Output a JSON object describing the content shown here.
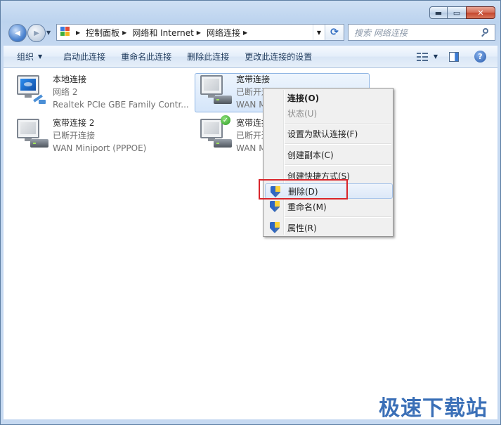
{
  "window": {
    "caption_buttons": {
      "minimize": "▬",
      "maximize": "▭",
      "close": "✕"
    }
  },
  "nav": {
    "back_symbol": "◀",
    "forward_symbol": "▶",
    "dropdown_symbol": "▼"
  },
  "address": {
    "breadcrumbs": [
      "控制面板",
      "网络和 Internet",
      "网络连接"
    ],
    "separator": "▶",
    "dropdown_symbol": "▼",
    "refresh_symbol": "⟳"
  },
  "search": {
    "placeholder": "搜索 网络连接"
  },
  "toolbar": {
    "organize": "组织",
    "start_connection": "启动此连接",
    "rename_connection": "重命名此连接",
    "delete_connection": "删除此连接",
    "change_settings": "更改此连接的设置",
    "dropdown_symbol": "▼",
    "help": "?"
  },
  "connections": [
    {
      "name": "本地连接",
      "line1": "网络  2",
      "line2": "Realtek PCIe GBE Family Contr..."
    },
    {
      "name": "宽带连接",
      "line1": "已断开连",
      "line2": "WAN M"
    },
    {
      "name": "宽带连接 2",
      "line1": "已断开连接",
      "line2": "WAN Miniport (PPPOE)"
    },
    {
      "name": "宽带连接",
      "line1": "已断开连",
      "line2": "WAN M"
    }
  ],
  "context_menu": {
    "connect": "连接(O)",
    "status": "状态(U)",
    "set_default": "设置为默认连接(F)",
    "create_copy": "创建副本(C)",
    "create_shortcut": "创建快捷方式(S)",
    "delete": "删除(D)",
    "rename": "重命名(M)",
    "properties": "属性(R)"
  },
  "check_symbol": "✓",
  "watermark": "极速下载站",
  "colors": {
    "highlight_box": "#d9252b",
    "watermark": "#3a6fb7",
    "selection": "#d4e5fa"
  }
}
